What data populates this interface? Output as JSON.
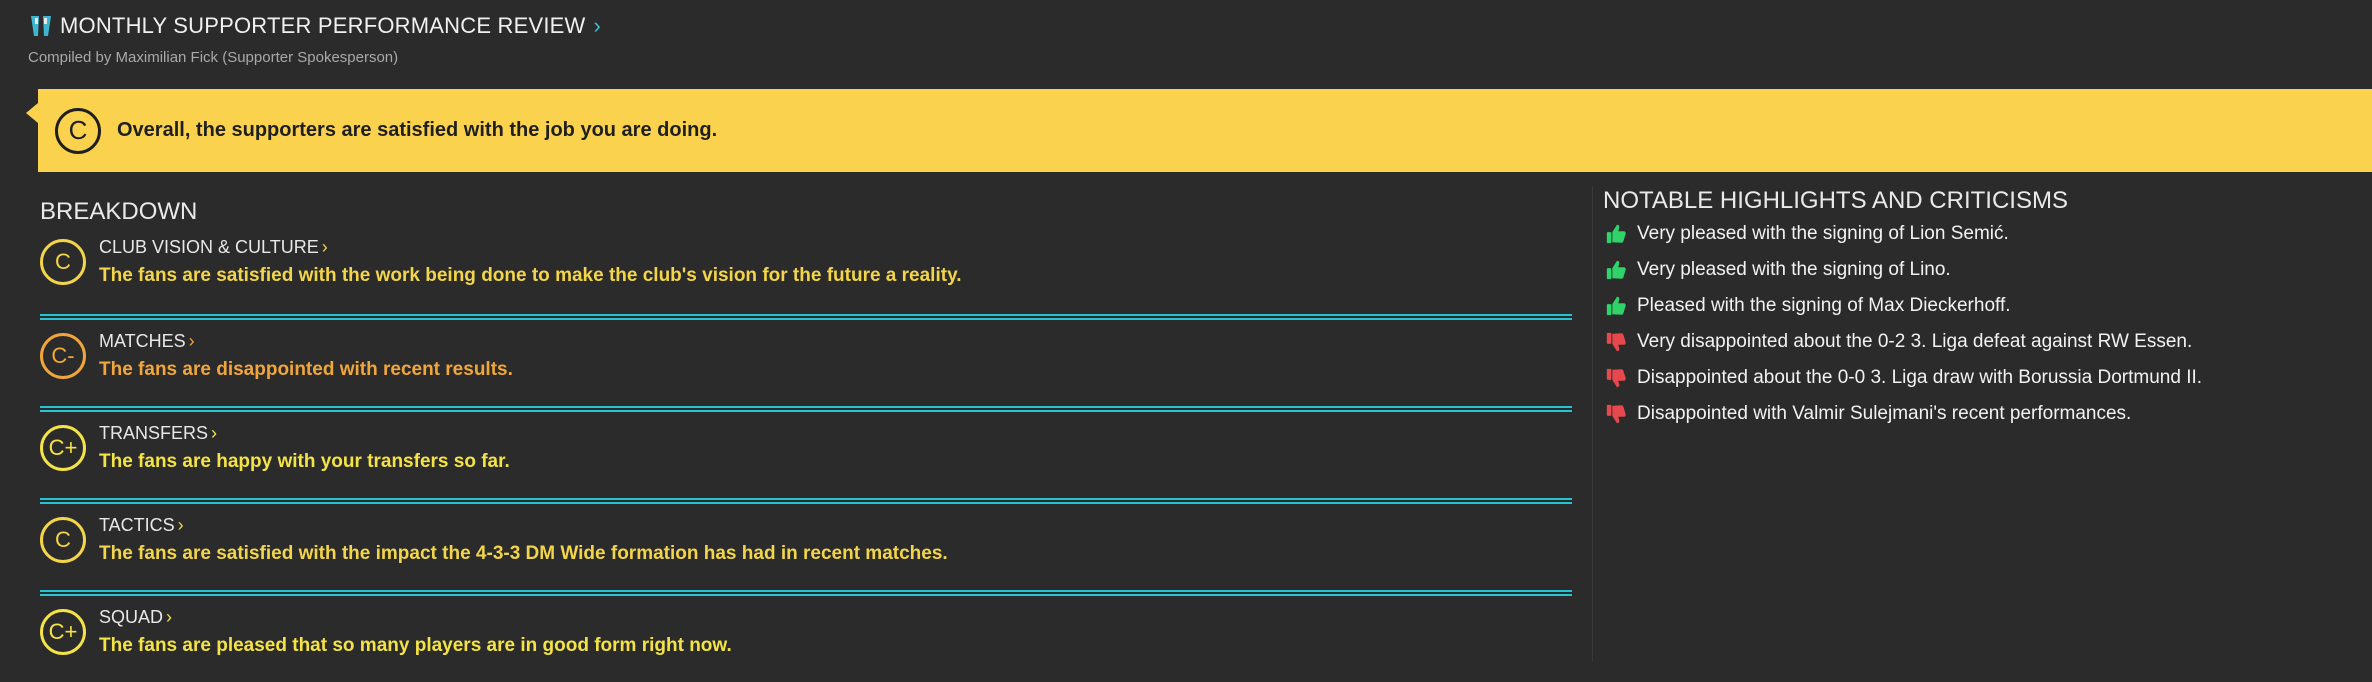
{
  "header": {
    "title": "MONTHLY SUPPORTER PERFORMANCE REVIEW",
    "subtitle": "Compiled by Maximilian Fick (Supporter Spokesperson)"
  },
  "banner": {
    "grade": "C",
    "text": "Overall, the supporters are satisfied with the job you are doing."
  },
  "breakdown": {
    "title": "BREAKDOWN",
    "items": [
      {
        "grade": "C",
        "heading": "CLUB VISION & CULTURE",
        "text": "The fans are satisfied with the work being done to make the club's vision for the future a reality.",
        "color": "#f2d54a"
      },
      {
        "grade": "C-",
        "heading": "MATCHES",
        "text": "The fans are disappointed with recent results.",
        "color": "#f0a63c"
      },
      {
        "grade": "C+",
        "heading": "TRANSFERS",
        "text": "The fans are happy with your transfers so far.",
        "color": "#f4e346"
      },
      {
        "grade": "C",
        "heading": "TACTICS",
        "text": "The fans are satisfied with the impact the 4-3-3 DM Wide formation has had in recent matches.",
        "color": "#f2d54a"
      },
      {
        "grade": "C+",
        "heading": "SQUAD",
        "text": "The fans are pleased that so many players are in good form right now.",
        "color": "#f4e346"
      }
    ]
  },
  "notables": {
    "title": "NOTABLE HIGHLIGHTS AND CRITICISMS",
    "items": [
      {
        "icon": "thumbs-up-icon",
        "text": "Very pleased with the signing of Lion Semić."
      },
      {
        "icon": "thumbs-up-icon",
        "text": "Very pleased with the signing of Lino."
      },
      {
        "icon": "thumbs-up-icon",
        "text": "Pleased with the signing of Max Dieckerhoff."
      },
      {
        "icon": "thumbs-down-icon",
        "text": "Very disappointed about the 0-2 3. Liga defeat against RW Essen."
      },
      {
        "icon": "thumbs-down-icon",
        "text": "Disappointed about the 0-0 3. Liga draw with Borussia Dortmund II."
      },
      {
        "icon": "thumbs-down-icon",
        "text": "Disappointed with Valmir Sulejmani's recent performances."
      }
    ]
  },
  "colors": {
    "background": "#2b2b2b",
    "banner": "#fbd24e",
    "divider": "#25c4d0",
    "thumbs_up": "#2fd36a",
    "thumbs_down": "#e5484d"
  }
}
